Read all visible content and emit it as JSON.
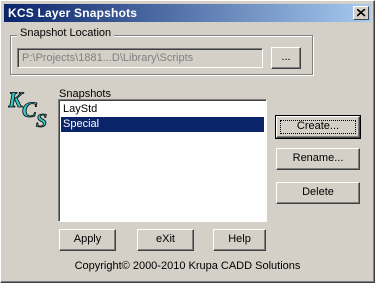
{
  "window": {
    "title": "KCS  Layer Snapshots"
  },
  "location": {
    "group_label": "Snapshot Location",
    "path_value": "P:\\Projects\\1881...D\\Library\\Scripts",
    "browse_label": "..."
  },
  "logo": {
    "text": "KCS"
  },
  "snapshots": {
    "label": "Snapshots",
    "items": [
      {
        "label": "LayStd",
        "selected": false
      },
      {
        "label": "Special",
        "selected": true
      }
    ]
  },
  "buttons": {
    "create": "Create...",
    "rename": "Rename...",
    "delete": "Delete",
    "apply": "Apply",
    "exit": "eXit",
    "help": "Help"
  },
  "footer": {
    "copyright": "Copyright© 2000-2010  Krupa CADD Solutions"
  },
  "colors": {
    "title_bar": "#0a246a",
    "selection": "#0a246a",
    "logo_fill": "#33cccc",
    "face": "#d4d0c8"
  }
}
